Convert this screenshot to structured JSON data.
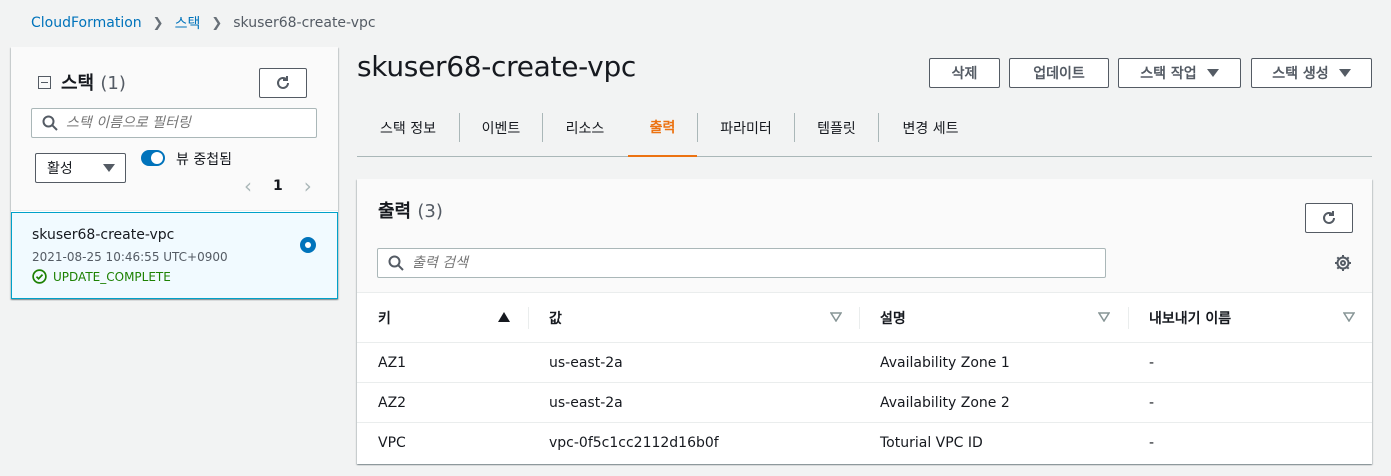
{
  "breadcrumb": {
    "root": "CloudFormation",
    "section": "스택",
    "current": "skuser68-create-vpc"
  },
  "stacks_panel": {
    "title": "스택",
    "count": "(1)",
    "filter_placeholder": "스택 이름으로 필터링",
    "status_filter": "활성",
    "nested_toggle_label": "뷰 중첩됨",
    "nested_toggle_on": true,
    "page": "1",
    "items": [
      {
        "name": "skuser68-create-vpc",
        "timestamp": "2021-08-25 10:46:55 UTC+0900",
        "status": "UPDATE_COMPLETE",
        "selected": true
      }
    ]
  },
  "stack_detail": {
    "title": "skuser68-create-vpc",
    "actions": {
      "delete": "삭제",
      "update": "업데이트",
      "stack_actions": "스택 작업",
      "create_stack": "스택 생성"
    },
    "tabs": [
      "스택 정보",
      "이벤트",
      "리소스",
      "출력",
      "파라미터",
      "템플릿",
      "변경 세트"
    ],
    "active_tab": "출력"
  },
  "outputs": {
    "title": "출력",
    "count": "(3)",
    "search_placeholder": "출력 검색",
    "columns": [
      "키",
      "값",
      "설명",
      "내보내기 이름"
    ],
    "rows": [
      {
        "key": "AZ1",
        "value": "us-east-2a",
        "description": "Availability Zone 1",
        "export": "-"
      },
      {
        "key": "AZ2",
        "value": "us-east-2a",
        "description": "Availability Zone 2",
        "export": "-"
      },
      {
        "key": "VPC",
        "value": "vpc-0f5c1cc2112d16b0f",
        "description": "Toturial VPC ID",
        "export": "-"
      }
    ]
  },
  "colors": {
    "link": "#0073bb",
    "active_tab": "#ec7211",
    "success": "#1d8102",
    "selected_bg": "#f1faff"
  }
}
